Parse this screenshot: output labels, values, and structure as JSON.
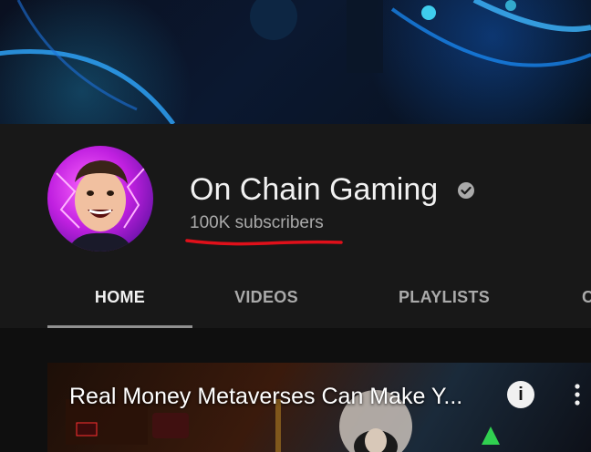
{
  "channel": {
    "name": "On Chain Gaming",
    "subscribers": "100K subscribers",
    "verified_icon": "verified-check-icon"
  },
  "tabs": [
    {
      "label": "HOME",
      "active": true
    },
    {
      "label": "VIDEOS",
      "active": false
    },
    {
      "label": "PLAYLISTS",
      "active": false
    },
    {
      "label": "C",
      "active": false
    }
  ],
  "featured_video": {
    "title": "Real Money Metaverses Can Make Y...",
    "info_icon": "i"
  },
  "colors": {
    "background": "#0f0f0f",
    "header": "#181818",
    "text_primary": "#f1f1f1",
    "text_secondary": "#aaaaaa",
    "annotation_red": "#e0101a"
  }
}
